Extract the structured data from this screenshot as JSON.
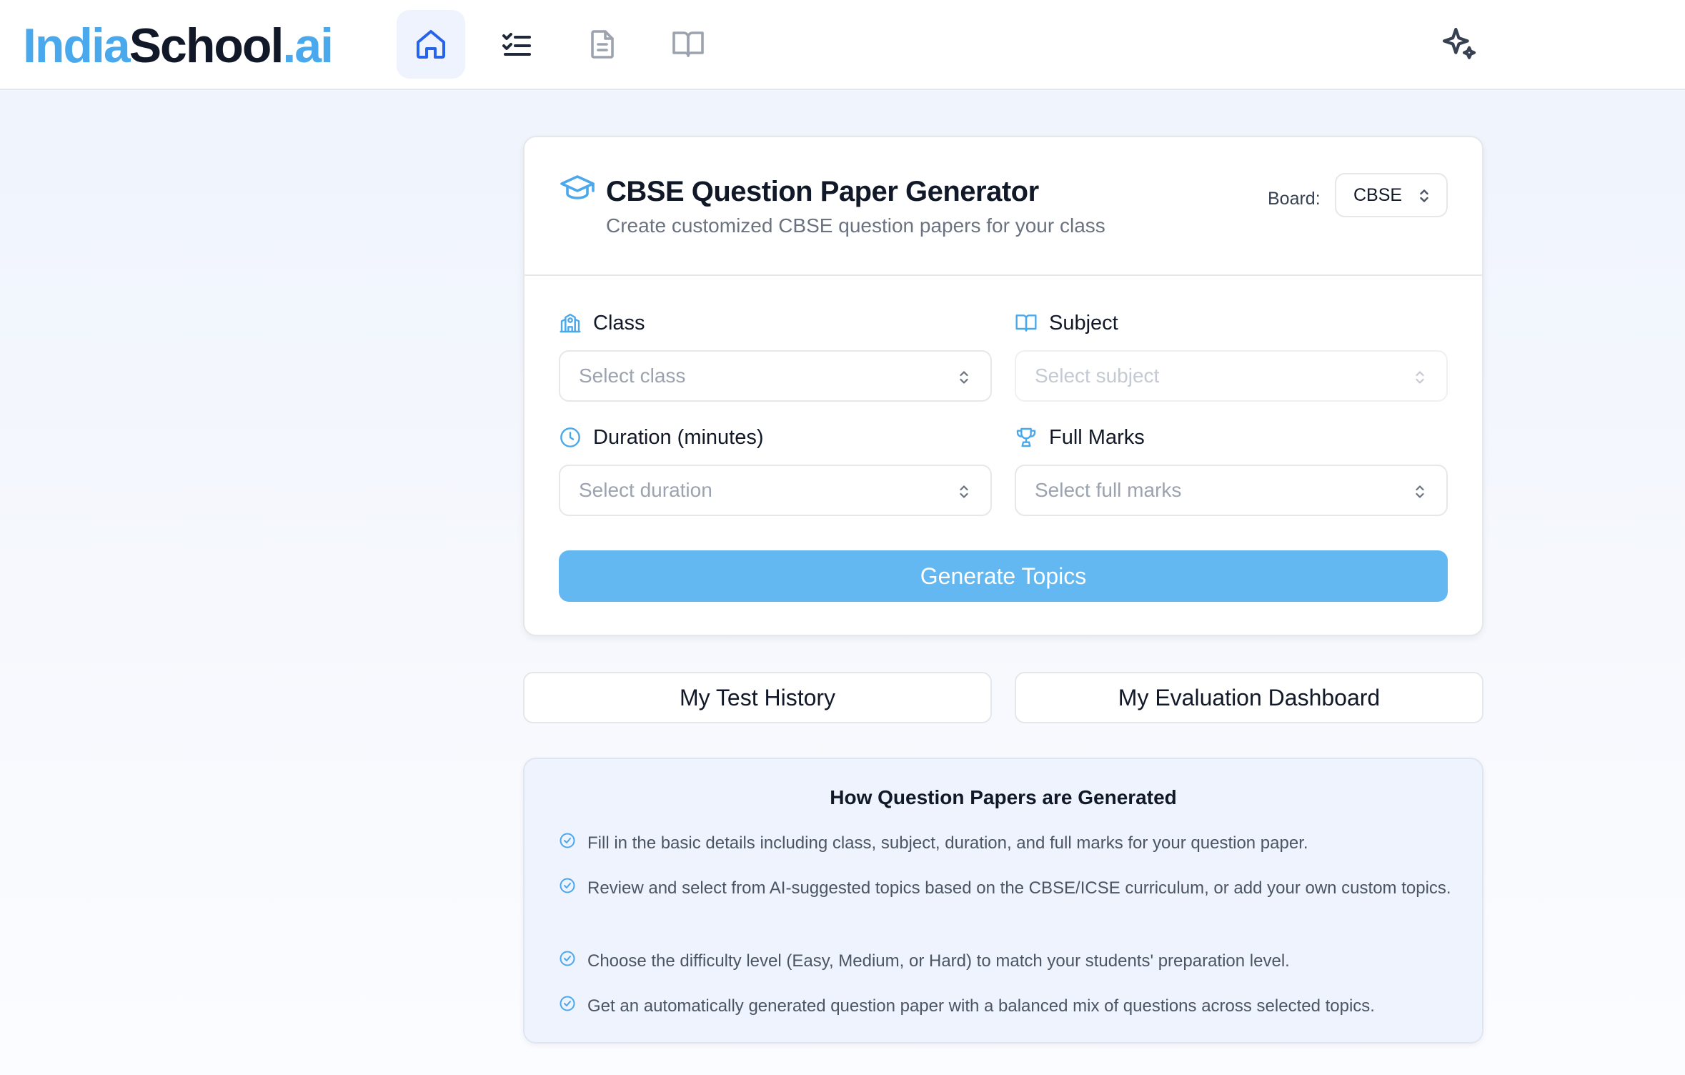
{
  "header": {
    "logo": {
      "part1": "India",
      "part2": "School",
      "part3": ".ai"
    },
    "nav": [
      {
        "icon": "home-icon",
        "active": true
      },
      {
        "icon": "checklist-icon",
        "active": false
      },
      {
        "icon": "document-icon",
        "active": false
      },
      {
        "icon": "book-icon",
        "active": false
      }
    ],
    "action_icon": "sparkles-icon"
  },
  "generator": {
    "title": "CBSE Question Paper Generator",
    "subtitle": "Create customized CBSE question papers for your class",
    "board_label": "Board:",
    "board_value": "CBSE",
    "fields": {
      "class": {
        "label": "Class",
        "placeholder": "Select class"
      },
      "subject": {
        "label": "Subject",
        "placeholder": "Select subject"
      },
      "duration": {
        "label": "Duration (minutes)",
        "placeholder": "Select duration"
      },
      "full_marks": {
        "label": "Full Marks",
        "placeholder": "Select full marks"
      }
    },
    "generate_label": "Generate Topics"
  },
  "links": {
    "history": "My Test History",
    "dashboard": "My Evaluation Dashboard"
  },
  "info": {
    "title": "How Question Papers are Generated",
    "steps": [
      "Fill in the basic details including class, subject, duration, and full marks for your question paper.",
      "Review and select from AI-suggested topics based on the CBSE/ICSE curriculum, or add your own custom topics.",
      "Choose the difficulty level (Easy, Medium, or Hard) to match your students' preparation level.",
      "Get an automatically generated question paper with a balanced mix of questions across selected topics."
    ]
  },
  "colors": {
    "accent": "#4aa8ec",
    "button": "#63b8f2",
    "text": "#111827",
    "muted": "#6b7280"
  }
}
